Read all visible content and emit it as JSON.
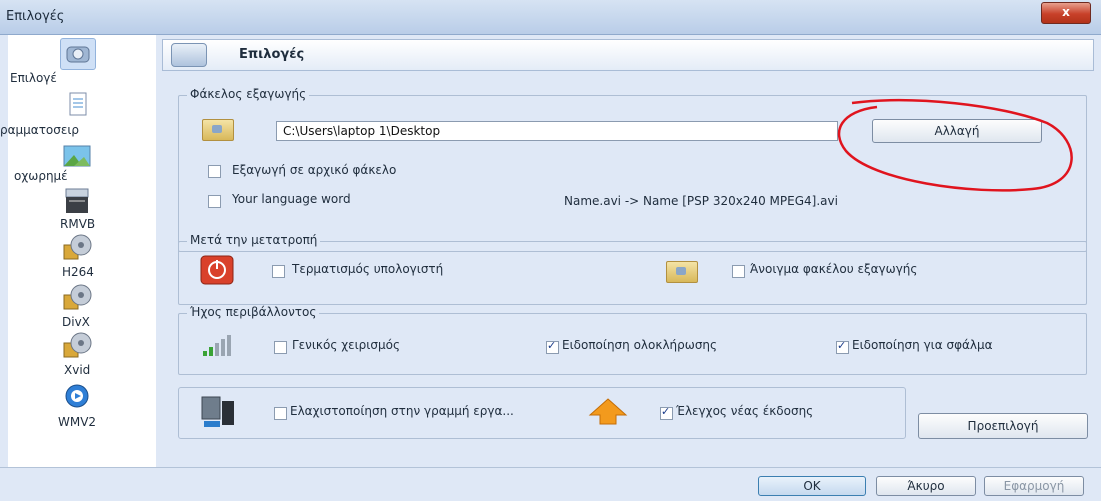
{
  "window": {
    "title": "Επιλογές",
    "close_label": "x"
  },
  "sidebar": {
    "items": [
      {
        "label": "Επιλογέ",
        "icon": "options-camera-icon"
      },
      {
        "label": "ραμματοσειρ",
        "icon": "font-document-icon"
      },
      {
        "label": "οχωρημέ",
        "icon": "image-icon"
      },
      {
        "label": "RMVB",
        "icon": "rmvb-clapboard-icon"
      },
      {
        "label": "H264",
        "icon": "film-reel-icon"
      },
      {
        "label": "DivX",
        "icon": "film-reel-icon"
      },
      {
        "label": "Xvid",
        "icon": "film-reel-icon"
      },
      {
        "label": "WMV2",
        "icon": "media-player-icon"
      }
    ]
  },
  "header": {
    "title": "Επιλογές"
  },
  "export_folder": {
    "group_title": "Φάκελος εξαγωγής",
    "path_value": "C:\\Users\\laptop 1\\Desktop",
    "change_button": "Αλλαγή",
    "export_to_original_label": "Εξαγωγή σε αρχικό φάκελο",
    "language_word_label": "Your language word",
    "example_text": "Name.avi  -> Name [PSP 320x240 MPEG4].avi"
  },
  "after_conversion": {
    "group_title": "Μετά την μετατροπή",
    "shutdown_label": "Τερματισμός υπολογιστή",
    "open_folder_label": "Άνοιγμα φακέλου εξαγωγής"
  },
  "ambient_sound": {
    "group_title": "Ήχος περιβάλλοντος",
    "general_label": "Γενικός χειρισμός",
    "completion_label": "Ειδοποίηση ολοκλήρωσης",
    "error_label": "Ειδοποίηση για σφάλμα"
  },
  "misc": {
    "minimize_label": "Ελαχιστοποίηση στην γραμμή εργα...",
    "update_label": "Έλεγχος νέας έκδοσης",
    "default_button": "Προεπιλογή"
  },
  "footer": {
    "ok": "OK",
    "cancel": "Άκυρο",
    "apply": "Εφαρμογή"
  },
  "colors": {
    "annotation_red": "#e0141e",
    "accent_blue": "#2a5aa8"
  }
}
